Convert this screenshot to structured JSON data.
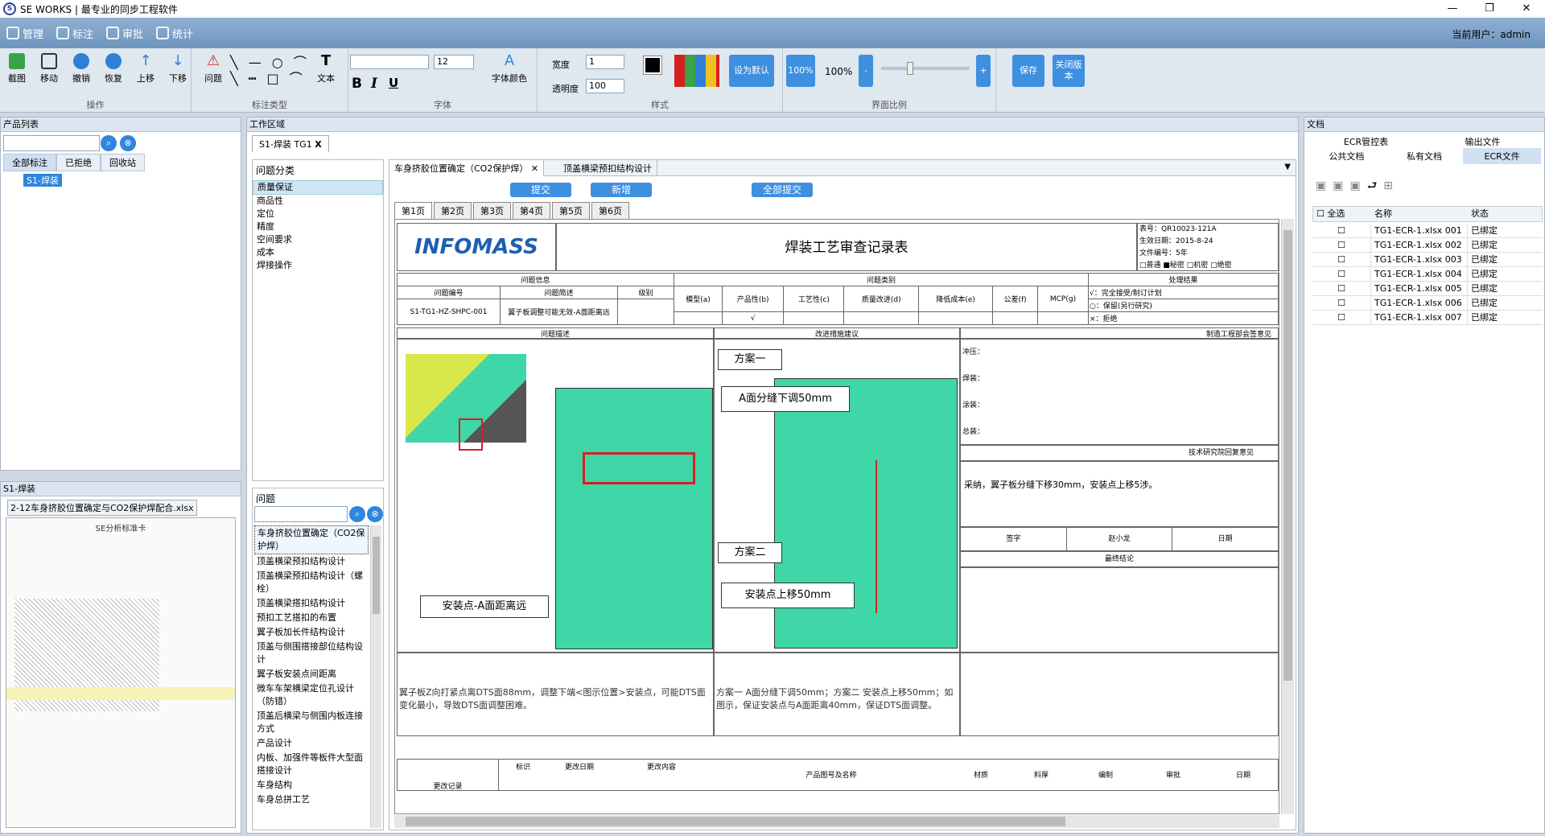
{
  "app": {
    "title": "SE WORKS | 最专业的同步工程软件",
    "user_label": "当前用户：admin"
  },
  "window_controls": {
    "min": "—",
    "max": "❐",
    "close": "✕"
  },
  "menu": [
    {
      "label": "管理"
    },
    {
      "label": "标注"
    },
    {
      "label": "审批"
    },
    {
      "label": "统计"
    }
  ],
  "toolbar": {
    "operations": [
      "截图",
      "移动",
      "撤销",
      "恢复",
      "上移",
      "下移"
    ],
    "operations_group": "操作",
    "annotate_btn": "问题",
    "text_btn": "文本",
    "annotate_group": "标注类型",
    "font_size": "12",
    "bold": "B",
    "italic": "I",
    "underline": "U",
    "font_color": "字体颜色",
    "font_group": "字体",
    "width_label": "宽度",
    "width_value": "1",
    "opacity_label": "透明度",
    "opacity_value": "100",
    "set_default": "设为默认",
    "style_group": "样式",
    "zoom_btn": "100%",
    "zoom_value": "100%",
    "zoom_minus": "-",
    "zoom_plus": "+",
    "zoom_group": "界面比例",
    "save": "保存",
    "close_version": "关闭版本"
  },
  "product_panel": {
    "title": "产品列表",
    "tabs": [
      "全部标注",
      "已拒绝",
      "回收站"
    ],
    "tree_item": "S1-焊装"
  },
  "s1_panel": {
    "title": "S1-焊装",
    "file": "2-12车身挤胶位置确定与CO2保护焊配合.xlsx",
    "thumb_title": "SE分析标准卡"
  },
  "work_area": {
    "title": "工作区域",
    "tab": "S1-焊装 TG1",
    "tab_close": "X"
  },
  "category": {
    "title": "问题分类",
    "items": [
      "质量保证",
      "商品性",
      "定位",
      "精度",
      "空间要求",
      "成本",
      "焊接操作"
    ]
  },
  "issues": {
    "title": "问题",
    "items": [
      "车身挤胶位置确定（CO2保护焊）",
      "顶盖横梁预扣结构设计",
      "顶盖横梁预扣结构设计（螺栓）",
      "顶盖横梁搭扣结构设计",
      "预扣工艺搭扣的布置",
      "翼子板加长件结构设计",
      "顶盖与侧围搭接部位结构设计",
      "翼子板安装点间距离",
      "微车车架横梁定位孔设计（防错）",
      "顶盖后横梁与侧围内板连接方式",
      "产品设计",
      "内板、加强件等板件大型面搭接设计",
      "车身结构",
      "车身总拼工艺"
    ]
  },
  "doc_tabs": {
    "tab1": "车身挤胶位置确定（CO2保护焊）",
    "tab1_close": "✕",
    "tab2": "顶盖横梁预扣结构设计"
  },
  "actions": {
    "submit": "提交",
    "add": "新增",
    "submit_all": "全部提交"
  },
  "pages": [
    "第1页",
    "第2页",
    "第3页",
    "第4页",
    "第5页",
    "第6页"
  ],
  "sheet": {
    "logo": "INFOMASS",
    "title": "焊装工艺审查记录表",
    "meta": [
      "表号：QR10023-121A",
      "生效日期：2015-8-24",
      "文件编号：5年"
    ],
    "secrecy": [
      "□普通",
      "■秘密",
      "□机密",
      "□绝密"
    ],
    "h_info": "问题信息",
    "h_category": "问题类别",
    "h_result": "处理结果",
    "col_no": "问题编号",
    "col_desc": "问题简述",
    "col_level": "级别",
    "cats": [
      "模型(a)",
      "产品性(b)",
      "工艺性(c)",
      "质量改进(d)",
      "降低成本(e)",
      "公差(f)",
      "MCP(g)"
    ],
    "row_no": "S1-TG1-HZ-SHPC-001",
    "row_desc": "翼子板调整可能无效-A面距离远",
    "check": "√",
    "results": [
      "√：完全接受/制订计划",
      "○：保留(另行研究)",
      "×：拒绝"
    ],
    "h_issue_desc": "问题描述",
    "h_suggest": "改进措施建议",
    "h_dept": "制造工程部会签意见",
    "signs": [
      "冲压：",
      "焊装：",
      "涂装：",
      "总装："
    ],
    "tech_label": "技术研究院回复意见",
    "tech_reply": "采纳，翼子板分缝下移30mm，安装点上移5涉。",
    "sign_row": [
      "签字",
      "赵小龙",
      "日期"
    ],
    "final": "最终结论",
    "plan1": "方案一",
    "plan1_text": "A面分缝下调50mm",
    "plan2": "方案二",
    "plan2_text": "安装点上移50mm",
    "callout": "安装点-A面距离远",
    "desc_text": "翼子板Z向打紧点离DTS面88mm，调整下端<图示位置>安装点，可能DTS面变化最小，导致DTS面调整困难。",
    "suggest_text": "方案一 A面分缝下调50mm；方案二 安装点上移50mm；如图示，保证安装点与A面距离40mm，保证DTS面调整。",
    "footer": [
      "标识",
      "更改日期",
      "更改内容",
      "产品图号及名称",
      "材质",
      "料厚",
      "编制",
      "审批",
      "日期"
    ],
    "footer_left": "更改记录"
  },
  "doc_panel": {
    "title": "文档",
    "tabs_top": [
      "ECR管控表",
      "输出文件"
    ],
    "tabs_bottom": [
      "公共文档",
      "私有文档",
      "ECR文件"
    ],
    "headers": [
      "全选",
      "名称",
      "状态"
    ],
    "rows": [
      {
        "name": "TG1-ECR-1.xlsx 001",
        "status": "已绑定"
      },
      {
        "name": "TG1-ECR-1.xlsx 002",
        "status": "已绑定"
      },
      {
        "name": "TG1-ECR-1.xlsx 003",
        "status": "已绑定"
      },
      {
        "name": "TG1-ECR-1.xlsx 004",
        "status": "已绑定"
      },
      {
        "name": "TG1-ECR-1.xlsx 005",
        "status": "已绑定"
      },
      {
        "name": "TG1-ECR-1.xlsx 006",
        "status": "已绑定"
      },
      {
        "name": "TG1-ECR-1.xlsx 007",
        "status": "已绑定"
      }
    ]
  },
  "colors": {
    "accent": "#3f8fe0",
    "cad_green": "#3fd6a8",
    "red": "#d62020"
  }
}
